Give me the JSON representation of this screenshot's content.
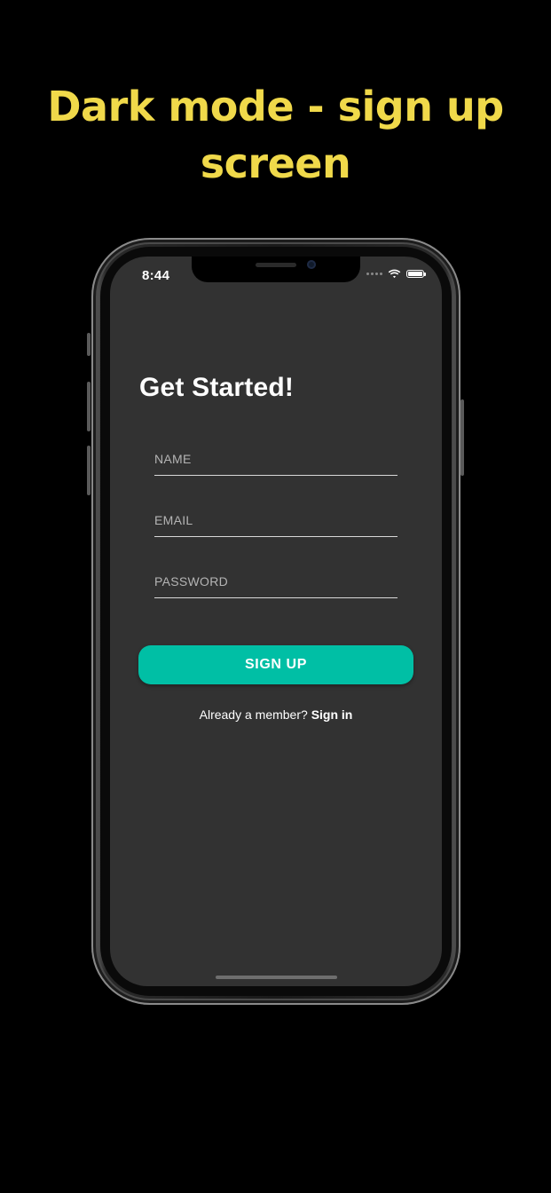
{
  "headline": {
    "line1": "Dark mode - sign up",
    "line2": "screen"
  },
  "status_bar": {
    "time": "8:44",
    "icons": [
      "signal-icon",
      "wifi-icon",
      "battery-icon"
    ]
  },
  "form": {
    "title": "Get Started!",
    "name_placeholder": "NAME",
    "email_placeholder": "EMAIL",
    "password_placeholder": "PASSWORD",
    "name_value": "",
    "email_value": "",
    "password_value": "",
    "submit_label": "SIGN UP",
    "member_prompt": "Already a member?",
    "signin_label": "Sign in"
  },
  "colors": {
    "headline": "#f0d94a",
    "screen_background": "#323232",
    "accent": "#00bfa5",
    "page_background": "#000000"
  }
}
